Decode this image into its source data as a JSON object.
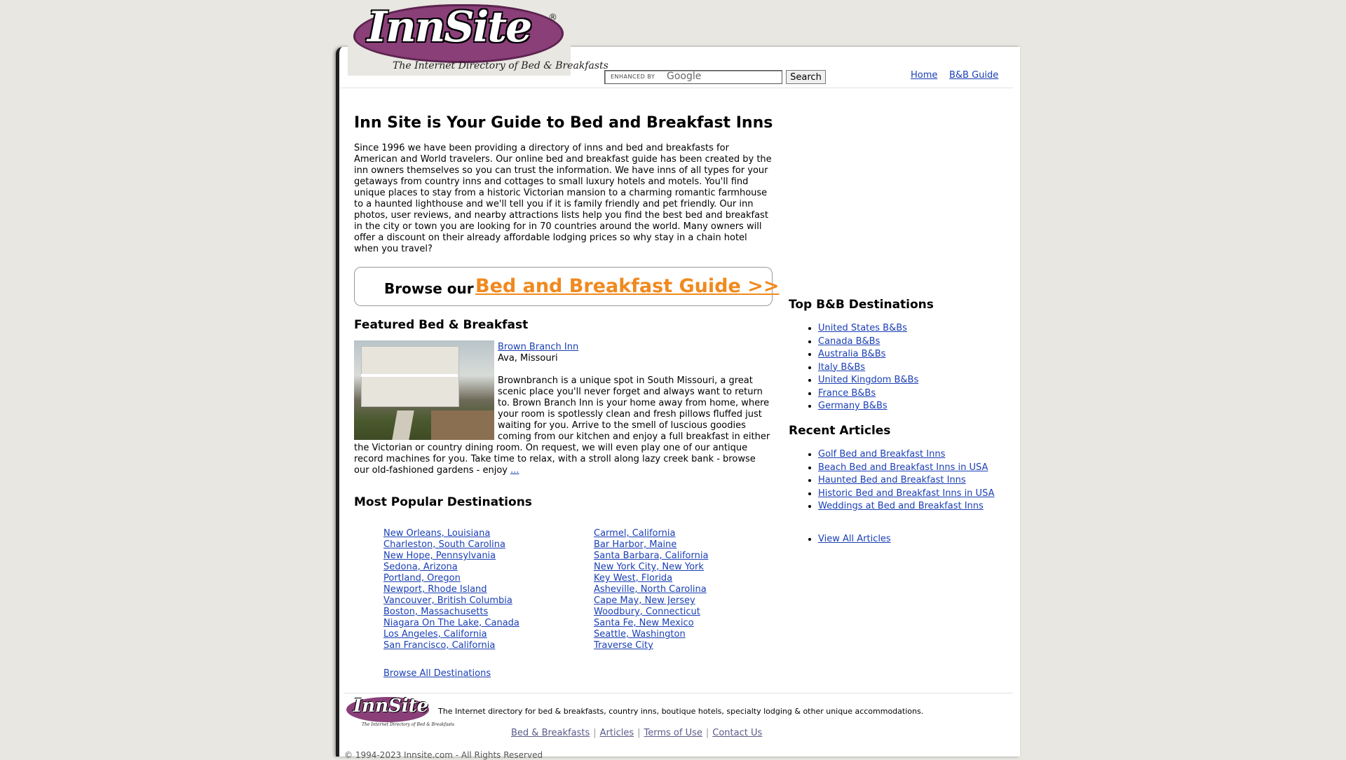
{
  "header": {
    "logo_text": "InnSite",
    "logo_registered": "®",
    "logo_tagline": "The Internet Directory of Bed & Breakfasts",
    "search": {
      "enhanced_by": "ENHANCED BY",
      "google": "Google",
      "button": "Search"
    },
    "nav": {
      "home": "Home",
      "guide": "B&B Guide"
    }
  },
  "main": {
    "title": "Inn Site is Your Guide to Bed and Breakfast Inns",
    "intro": "Since 1996 we have been providing a directory of inns and bed and breakfasts for American and World travelers. Our online bed and breakfast guide has been created by the inn owners themselves so you can trust the information. We have inns of all types for your getaways from country inns and cottages to small luxury hotels and motels. You'll find unique places to stay from a historic Victorian mansion to a charming romantic farmhouse to a haunted lighthouse and we'll tell you if it is family friendly and pet friendly. Our inn photos, user reviews, and nearby attractions lists help you find the best bed and breakfast in the city or town you are looking for in 70 countries around the world. Many owners will offer a discount on their already affordable lodging prices so why stay in a chain hotel when you travel?",
    "browse_label": "Browse our",
    "browse_link": "Bed and Breakfast Guide >>"
  },
  "featured": {
    "heading": "Featured Bed & Breakfast",
    "name": "Brown Branch Inn",
    "location": "Ava, Missouri",
    "description": "Brownbranch is a unique spot in South Missouri, a great scenic place you'll never forget and always want to return to. Brown Branch Inn is your home away from home, where your room is spotlessly clean and fresh pillows fluffed just waiting for you. Arrive to the smell of luscious goodies coming from our kitchen and enjoy a full breakfast in either the Victorian or country dining room. On request, we will even play one of our antique record machines for you. Take time to relax, with a stroll along lazy creek bank - browse our old-fashioned gardens - enjoy",
    "more": "..."
  },
  "popular": {
    "heading": "Most Popular Destinations",
    "col_a": [
      "New Orleans, Louisiana",
      "Charleston, South Carolina",
      "New Hope, Pennsylvania",
      "Sedona, Arizona",
      "Portland, Oregon",
      "Newport, Rhode Island",
      "Vancouver, British Columbia",
      "Boston, Massachusetts",
      "Niagara On The Lake, Canada",
      "Los Angeles, California",
      "San Francisco, California"
    ],
    "col_b": [
      "Carmel, California",
      "Bar Harbor, Maine",
      "Santa Barbara, California",
      "New York City, New York",
      "Key West, Florida",
      "Asheville, North Carolina",
      "Cape May, New Jersey",
      "Woodbury, Connecticut",
      "Santa Fe, New Mexico",
      "Seattle, Washington",
      "Traverse City"
    ],
    "browse_all": "Browse All Destinations"
  },
  "sidebar": {
    "destinations_heading": "Top B&B Destinations",
    "destinations": [
      "United States B&Bs",
      "Canada B&Bs",
      "Australia B&Bs",
      "Italy B&Bs",
      "United Kingdom B&Bs",
      "France B&Bs",
      "Germany B&Bs"
    ],
    "articles_heading": "Recent Articles",
    "articles": [
      "Golf Bed and Breakfast Inns",
      "Beach Bed and Breakfast Inns in USA",
      "Haunted Bed and Breakfast Inns",
      "Historic Bed and Breakfast Inns in USA",
      "Weddings at Bed and Breakfast Inns"
    ],
    "view_all": "View All Articles"
  },
  "footer": {
    "logo_text": "InnSite",
    "logo_tagline": "The Internet Directory of Bed & Breakfasts",
    "tagline": "The Internet directory for bed & breakfasts, country inns, boutique hotels, specialty lodging & other unique accommodations.",
    "links": [
      "Bed & Breakfasts",
      "Articles",
      "Terms of Use",
      "Contact Us"
    ],
    "separator": "|",
    "copyright": "© 1994-2023 Innsite.com - All Rights Reserved"
  },
  "colors": {
    "page_bg": "#e8e7e1",
    "link": "#1a3fb5",
    "accent_orange": "#f0891e",
    "logo_purple": "#8a3f79"
  }
}
